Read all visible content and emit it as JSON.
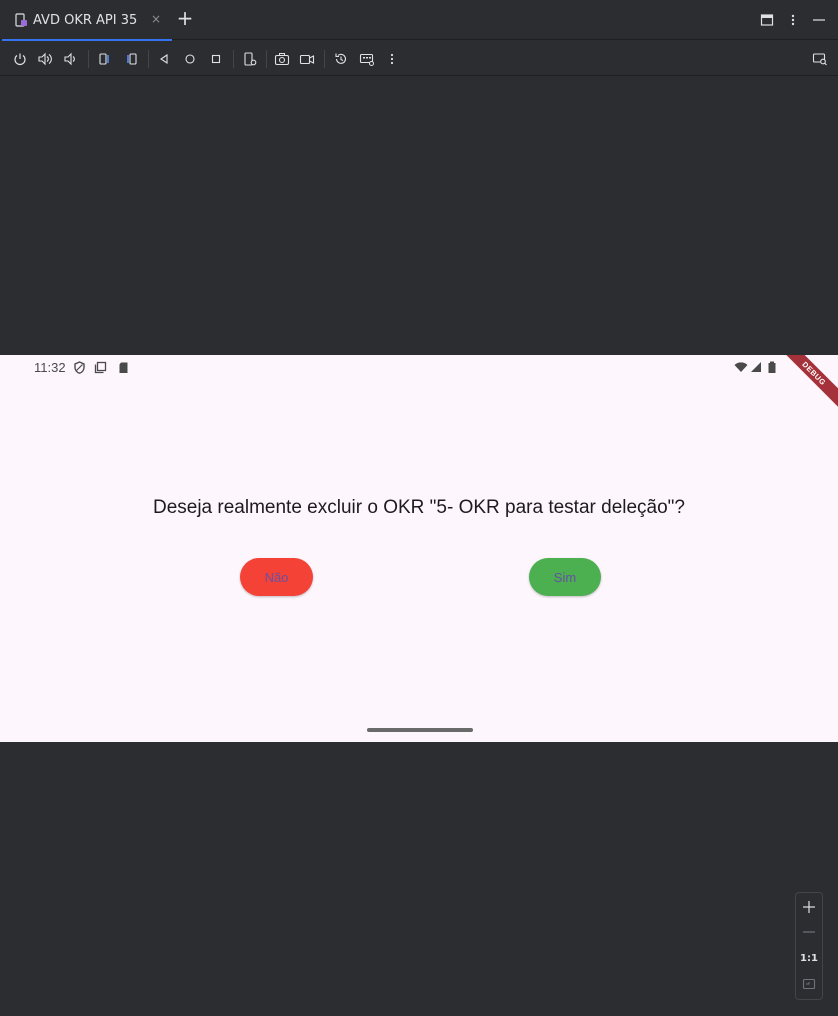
{
  "tab": {
    "title": "AVD OKR API 35",
    "close": "×",
    "add": "+"
  },
  "device": {
    "status_time": "11:32",
    "debug_banner": "DEBUG",
    "question": "Deseja realmente excluir o OKR \"5- OKR para testar deleção\"?",
    "no_label": "Não",
    "yes_label": "Sim",
    "colors": {
      "no_button": "#f44336",
      "yes_button": "#4caf50",
      "accent": "#3574f0"
    }
  },
  "zoom": {
    "ratio_label": "1:1"
  },
  "icons": {
    "tab": "device-icon",
    "window_controls": [
      "window-icon",
      "more-vertical-icon",
      "minimize-icon"
    ],
    "toolbar": [
      "power-icon",
      "volume-up-icon",
      "volume-down-icon",
      "rotate-left-icon",
      "rotate-right-icon",
      "back-icon",
      "home-icon",
      "overview-icon",
      "device-settings-icon",
      "camera-icon",
      "record-icon",
      "snapshot-icon",
      "keyboard-icon",
      "more-vertical-icon",
      "device-mirror-icon"
    ]
  }
}
